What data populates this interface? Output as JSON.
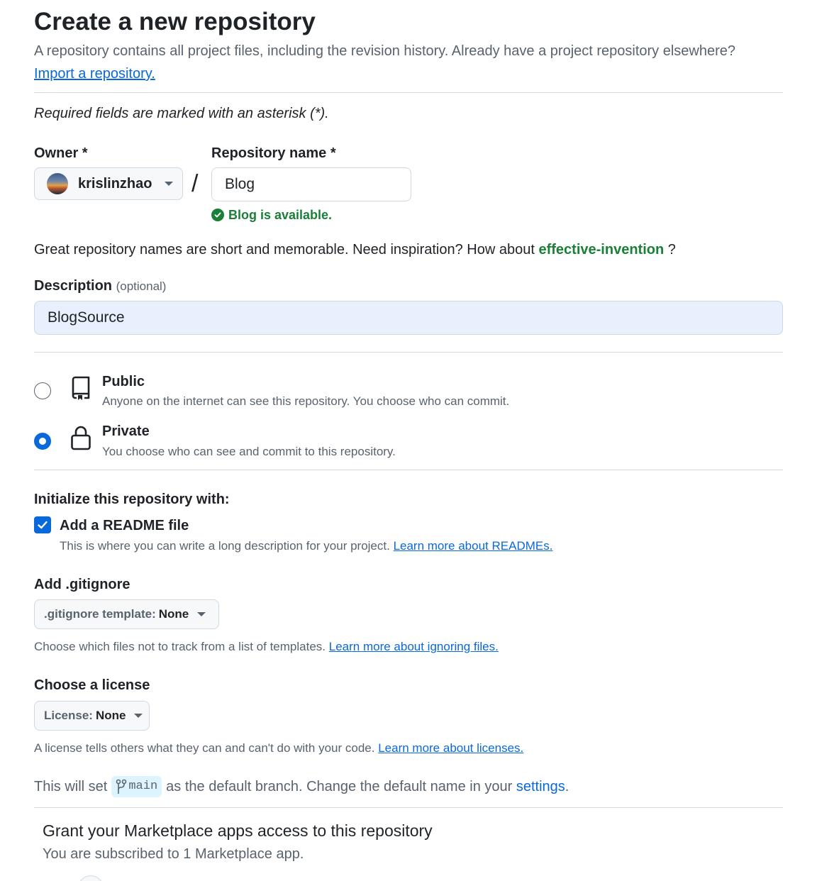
{
  "header": {
    "title": "Create a new repository",
    "subtitle": "A repository contains all project files, including the revision history. Already have a project repository elsewhere?",
    "import_link": "Import a repository."
  },
  "required_note": "Required fields are marked with an asterisk (*).",
  "owner": {
    "label": "Owner *",
    "value": "krislinzhao"
  },
  "slash": "/",
  "repo_name": {
    "label": "Repository name *",
    "value": "Blog",
    "availability": "Blog is available."
  },
  "inspiration": {
    "prefix": "Great repository names are short and memorable. Need inspiration? How about",
    "suggestion": "effective-invention",
    "suffix": "?"
  },
  "description": {
    "label": "Description",
    "optional": "(optional)",
    "value": "BlogSource"
  },
  "visibility": {
    "public": {
      "title": "Public",
      "description": "Anyone on the internet can see this repository. You choose who can commit.",
      "selected": false
    },
    "private": {
      "title": "Private",
      "description": "You choose who can see and commit to this repository.",
      "selected": true
    }
  },
  "initialize": {
    "label": "Initialize this repository with:",
    "readme": {
      "label": "Add a README file",
      "checked": true,
      "description": "This is where you can write a long description for your project.",
      "link": "Learn more about READMEs."
    }
  },
  "gitignore": {
    "label": "Add .gitignore",
    "prefix": ".gitignore template:",
    "value": "None",
    "description": "Choose which files not to track from a list of templates.",
    "link": "Learn more about ignoring files."
  },
  "license": {
    "label": "Choose a license",
    "prefix": "License:",
    "value": "None",
    "description": "A license tells others what they can and can't do with your code.",
    "link": "Learn more about licenses."
  },
  "branch": {
    "prefix": "This will set",
    "name": "main",
    "middle": "as the default branch. Change the default name in your",
    "settings_link": "settings",
    "suffix": "."
  },
  "marketplace": {
    "title": "Grant your Marketplace apps access to this repository",
    "subtitle": "You are subscribed to 1 Marketplace app."
  },
  "colors": {
    "accent": "#0969da",
    "success": "#1a7f37",
    "muted_text": "#59636e",
    "border": "#d1d9e0"
  },
  "icons": {
    "public": "repo-icon",
    "private": "lock-icon",
    "branch": "git-branch-icon",
    "check": "check-circle-icon"
  }
}
